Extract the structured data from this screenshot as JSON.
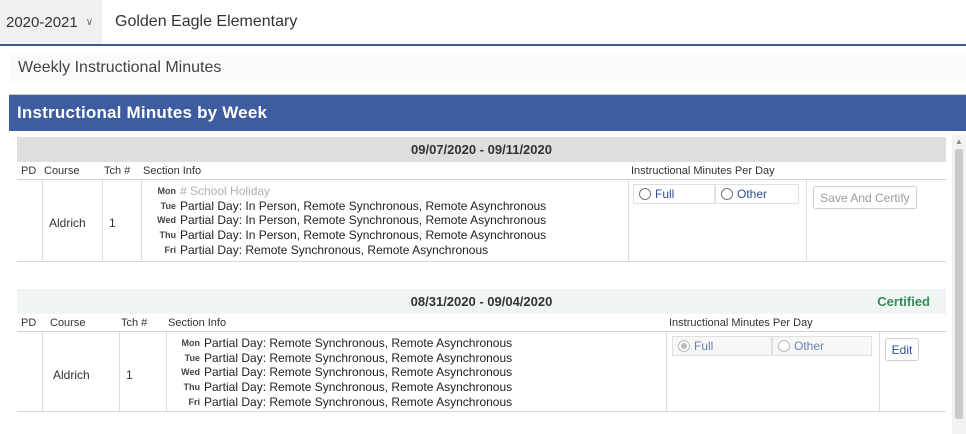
{
  "topbar": {
    "year": "2020-2021",
    "school": "Golden Eagle Elementary"
  },
  "page_title": "Weekly Instructional Minutes",
  "panel": {
    "title": "Instructional Minutes by Week"
  },
  "columns": {
    "pd": "PD",
    "course": "Course",
    "tch": "Tch #",
    "section": "Section Info",
    "minutes": "Instructional Minutes Per Day"
  },
  "weeks": [
    {
      "range": "09/07/2020 - 09/11/2020",
      "status": "",
      "course": "Aldrich",
      "tch": "1",
      "days": [
        {
          "label": "Mon",
          "text": "# School Holiday"
        },
        {
          "label": "Tue",
          "text": "Partial Day: In Person, Remote Synchronous, Remote Asynchronous"
        },
        {
          "label": "Wed",
          "text": "Partial Day: In Person, Remote Synchronous, Remote Asynchronous"
        },
        {
          "label": "Thu",
          "text": "Partial Day: In Person, Remote Synchronous, Remote Asynchronous"
        },
        {
          "label": "Fri",
          "text": "Partial Day: Remote Synchronous, Remote Asynchronous"
        }
      ],
      "options": {
        "full": "Full",
        "other": "Other"
      },
      "button": "Save And Certify"
    },
    {
      "range": "08/31/2020 - 09/04/2020",
      "status": "Certified",
      "course": "Aldrich",
      "tch": "1",
      "days": [
        {
          "label": "Mon",
          "text": "Partial Day: Remote Synchronous, Remote Asynchronous"
        },
        {
          "label": "Tue",
          "text": "Partial Day: Remote Synchronous, Remote Asynchronous"
        },
        {
          "label": "Wed",
          "text": "Partial Day: Remote Synchronous, Remote Asynchronous"
        },
        {
          "label": "Thu",
          "text": "Partial Day: Remote Synchronous, Remote Asynchronous"
        },
        {
          "label": "Fri",
          "text": "Partial Day: Remote Synchronous, Remote Asynchronous"
        }
      ],
      "options": {
        "full": "Full",
        "other": "Other"
      },
      "button": "Edit"
    }
  ],
  "colors": {
    "header_blue": "#3d5da0",
    "certified_green": "#3a8a5a",
    "link_blue": "#2a4f9a"
  }
}
